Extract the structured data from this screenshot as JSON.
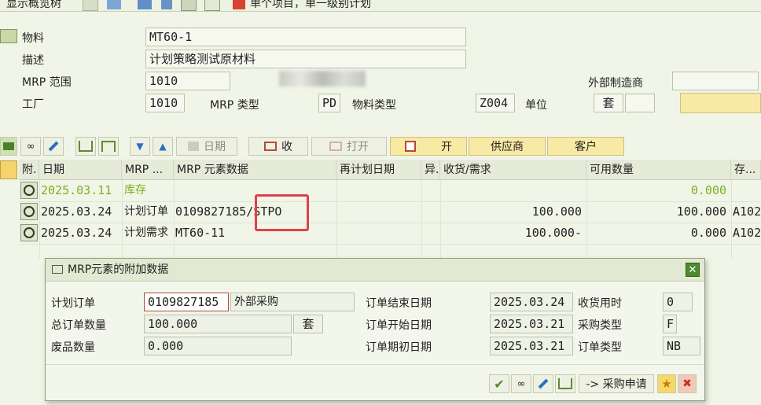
{
  "top_toolbar": {
    "show_overview_tree": "显示概览树",
    "single_item_label": "单个项目，单一级别计划"
  },
  "header": {
    "material_label": "物料",
    "material_value": "MT60-1",
    "desc_label": "描述",
    "desc_value": "计划策略测试原材料",
    "mrp_area_label": "MRP 范围",
    "mrp_area_value": "1010",
    "ext_mfr_label": "外部制造商",
    "ext_mfr_value": "",
    "plant_label": "工厂",
    "plant_value": "1010",
    "mrp_type_label": "MRP 类型",
    "mrp_type_value": "PD",
    "mat_type_label": "物料类型",
    "mat_type_value": "Z004",
    "unit_label": "单位",
    "unit_value": "套"
  },
  "toolbar2": {
    "date_label": "日期",
    "receipt_label": "收",
    "open_label": "打开",
    "open2_label": "开",
    "vendor_label": "供应商",
    "customer_label": "客户"
  },
  "grid": {
    "columns": [
      "附.",
      "日期",
      "MRP ...",
      "MRP 元素数据",
      "再计划日期",
      "异.",
      "收货/需求",
      "可用数量",
      "存..."
    ],
    "rows": [
      {
        "date": "2025.03.11",
        "element": "库存",
        "data": "",
        "reschedule": "",
        "exc": "",
        "qty": "",
        "available": "0.000",
        "storage": ""
      },
      {
        "date": "2025.03.24",
        "element": "计划订单",
        "data": "0109827185/STPO",
        "reschedule": "",
        "exc": "",
        "qty": "100.000",
        "available": "100.000",
        "storage": "A102"
      },
      {
        "date": "2025.03.24",
        "element": "计划需求",
        "data": "MT60-11",
        "reschedule": "",
        "exc": "",
        "qty": "100.000-",
        "available": "0.000",
        "storage": "A102"
      }
    ]
  },
  "dialog": {
    "title": "MRP元素的附加数据",
    "planned_order_label": "计划订单",
    "planned_order_value": "0109827185",
    "procurement_value": "外部采购",
    "total_qty_label": "总订单数量",
    "total_qty_value": "100.000",
    "total_qty_unit": "套",
    "scrap_label": "废品数量",
    "scrap_value": "0.000",
    "order_end_label": "订单结束日期",
    "order_end_value": "2025.03.24",
    "order_start_label": "订单开始日期",
    "order_start_value": "2025.03.21",
    "order_open_label": "订单期初日期",
    "order_open_value": "2025.03.21",
    "gr_time_label": "收货用时",
    "gr_time_value": "0",
    "proc_type_label": "采购类型",
    "proc_type_value": "F",
    "order_type_label": "订单类型",
    "order_type_value": "NB",
    "purchase_req_button": "-> 采购申请"
  },
  "colors": {
    "bg": "#f1f5e8",
    "highlight_red": "#e0404a",
    "green_text": "#7db01f",
    "yellow_button": "#f8e9a5"
  }
}
